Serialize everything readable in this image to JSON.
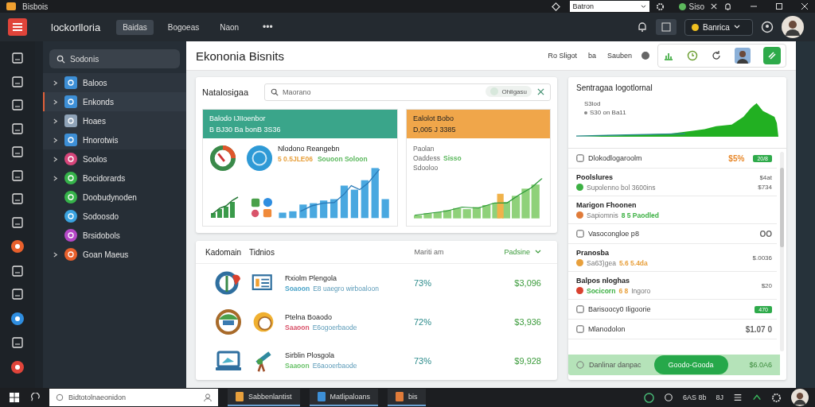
{
  "title_bar": {
    "title": "Bisbois",
    "dropdown": "Batron",
    "status": "Siso"
  },
  "app_header": {
    "brand": "lockorlloria",
    "more": "•••",
    "account": "Banrica",
    "tabs": [
      {
        "label": "Baidas",
        "selected": true
      },
      {
        "label": "Bogoeas",
        "selected": false
      },
      {
        "label": "Naon",
        "selected": false
      }
    ]
  },
  "sidebar": {
    "search": {
      "placeholder": "Sodonis"
    },
    "items": [
      {
        "label": "Baloos",
        "kind": "group",
        "color": "#3d8fd6",
        "selected": false
      },
      {
        "label": "Enkonds",
        "kind": "group",
        "color": "#3d8fd6",
        "selected": true
      },
      {
        "label": "Hoaes",
        "kind": "group",
        "color": "#8fa3b8",
        "selected": false
      },
      {
        "label": "Hnorotwis",
        "kind": "group",
        "color": "#3d8fd6",
        "selected": false
      },
      {
        "label": "Soolos",
        "kind": "group",
        "color": "#d6457a",
        "selected": false
      },
      {
        "label": "Bocidorards",
        "kind": "group",
        "color": "#36b34a",
        "selected": false
      },
      {
        "label": "Doobudynoden",
        "kind": "leaf",
        "color": "#36b34a",
        "selected": false
      },
      {
        "label": "Sodoosdo",
        "kind": "leaf",
        "color": "#3aa3e0",
        "selected": false
      },
      {
        "label": "Brsidobols",
        "kind": "leaf",
        "color": "#b548c6",
        "selected": false
      },
      {
        "label": "Goan Maeus",
        "kind": "group",
        "color": "#e8602c",
        "selected": false
      }
    ]
  },
  "page": {
    "title": "Ekononia Bisnits",
    "toolbar": [
      "Ro Sligot",
      "ba",
      "Sauben"
    ]
  },
  "overview": {
    "title": "Natalosigaa",
    "search": {
      "placeholder": "Maorano"
    },
    "chip": "Ohligasu",
    "cards": [
      {
        "kind": "bars",
        "color": "#3aa58a",
        "heading": "Balodo IJIIoenbor",
        "subheading": "B BJ30 Ba bonB 3S36",
        "title": "Nlodono Reangebn",
        "parts": [
          {
            "text": "5 0.5JLE06",
            "color": "#e8a03c"
          },
          {
            "text": "Souoon Soloon",
            "color": "#5bb85d"
          }
        ]
      },
      {
        "kind": "area",
        "color": "#f0a64a",
        "heading": "Ealolot Bobo",
        "subheading": "D,005 J 3385",
        "lines": [
          [
            {
              "text": "Paolan"
            }
          ],
          [
            {
              "text": "Oaddess"
            },
            {
              "text": "Sisso",
              "color": "#5bb85d"
            }
          ],
          [
            {
              "text": "Sdooloo"
            }
          ]
        ]
      }
    ]
  },
  "table": {
    "title": "Kadomain",
    "subtitle": "Tidnios",
    "column_a": "Mariti am",
    "column_b": "Padsine",
    "rows": [
      {
        "title": "Rxiolm Plengola",
        "tag": {
          "text": "Soaoon",
          "color": "#4aa3c8"
        },
        "detail": "E8 uaegro wirboaloon",
        "percent": "73%",
        "amount": "$3,096"
      },
      {
        "title": "Ptelna Boaodo",
        "tag": {
          "text": "Saaoon",
          "color": "#d9536a"
        },
        "detail": "E6ogoerbaode",
        "percent": "72%",
        "amount": "$3,936"
      },
      {
        "title": "Sirblin Plosgola",
        "tag": {
          "text": "Saaoon",
          "color": "#6cc36c"
        },
        "detail": "E6aooerbaode",
        "percent": "73%",
        "amount": "$9,928"
      }
    ]
  },
  "panel": {
    "title": "Sentragaa Iogotlornal",
    "legend": [
      "S3lod",
      "S30 on Ba11"
    ],
    "rows": [
      {
        "kind": "line",
        "label": "Dlokodlogaroolm",
        "value": {
          "text": "$5%",
          "color": "#e8892c"
        },
        "badge": "20/8"
      },
      {
        "kind": "double",
        "title": "Poolslures",
        "color": "#3cb043",
        "parts": [
          {
            "text": "Supolenno bol 3600ins"
          }
        ],
        "values": [
          "$4at",
          "$734"
        ]
      },
      {
        "kind": "double",
        "title": "Marigon Fhoonen",
        "color": "#e07b39",
        "parts": [
          {
            "text": "Sapiomnis"
          },
          {
            "text": "8 5 Paodled",
            "color": "#3cb043"
          }
        ],
        "values": []
      },
      {
        "kind": "line",
        "label": "Vasocongloe p8",
        "value": {
          "text": "OO"
        }
      },
      {
        "kind": "double",
        "title": "Pranosba",
        "color": "#e8a03c",
        "parts": [
          {
            "text": "Sa63)gea"
          },
          {
            "text": "5.6 5.4da",
            "color": "#e8a03c"
          }
        ],
        "values": [
          "$.0036"
        ]
      },
      {
        "kind": "double",
        "title": "Balpos nloghas",
        "color": "#d9412f",
        "parts": [
          {
            "text": "Socicorn",
            "color": "#3cb043"
          },
          {
            "text": "6 8",
            "color": "#e8a03c"
          },
          {
            "text": "Ingoro"
          }
        ],
        "values": [
          "$20"
        ]
      },
      {
        "kind": "line",
        "label": "Barisoocy0 Iligoorie",
        "badge": "470"
      },
      {
        "kind": "line",
        "label": "Mlanodolon",
        "value": {
          "text": "$1.07 0"
        }
      }
    ],
    "footer": {
      "label": "Danlinar danpac",
      "button": "Goodo-Gooda",
      "amount": "$6.0A6"
    }
  },
  "taskbar": {
    "search": {
      "placeholder": "Bidtotolnaeonidon"
    },
    "apps": [
      {
        "label": "Sabbenlantist",
        "color": "#e8a03c"
      },
      {
        "label": "Matlipaloans",
        "color": "#3d8fd6"
      },
      {
        "label": "bis",
        "color": "#e07b39"
      }
    ],
    "tray": [
      "6AS 8b",
      "8J"
    ]
  }
}
